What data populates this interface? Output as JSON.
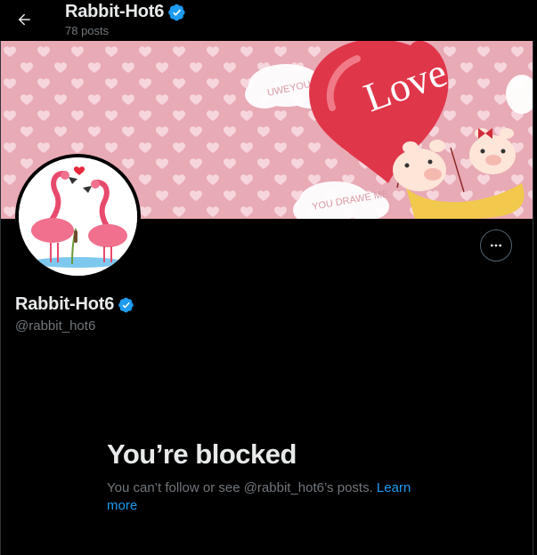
{
  "header": {
    "title": "Rabbit-Hot6",
    "posts_count": "78 posts"
  },
  "banner": {
    "love_text": "Love",
    "cloud_text_1": "UWEYOU DRA",
    "cloud_text_2": "YOU DRAWE ME"
  },
  "profile": {
    "display_name": "Rabbit-Hot6",
    "handle": "@rabbit_hot6",
    "verified": true
  },
  "blocked": {
    "title": "You’re blocked",
    "message": "You can’t follow or see @rabbit_hot6’s posts.",
    "link_text": "Learn more"
  },
  "colors": {
    "background": "#000000",
    "accent": "#1d9bf0",
    "secondary_text": "#71767b",
    "banner_bg": "#e8aab5",
    "balloon": "#e0364a"
  },
  "icons": [
    "back-arrow-icon",
    "verified-badge-icon",
    "more-options-icon"
  ]
}
